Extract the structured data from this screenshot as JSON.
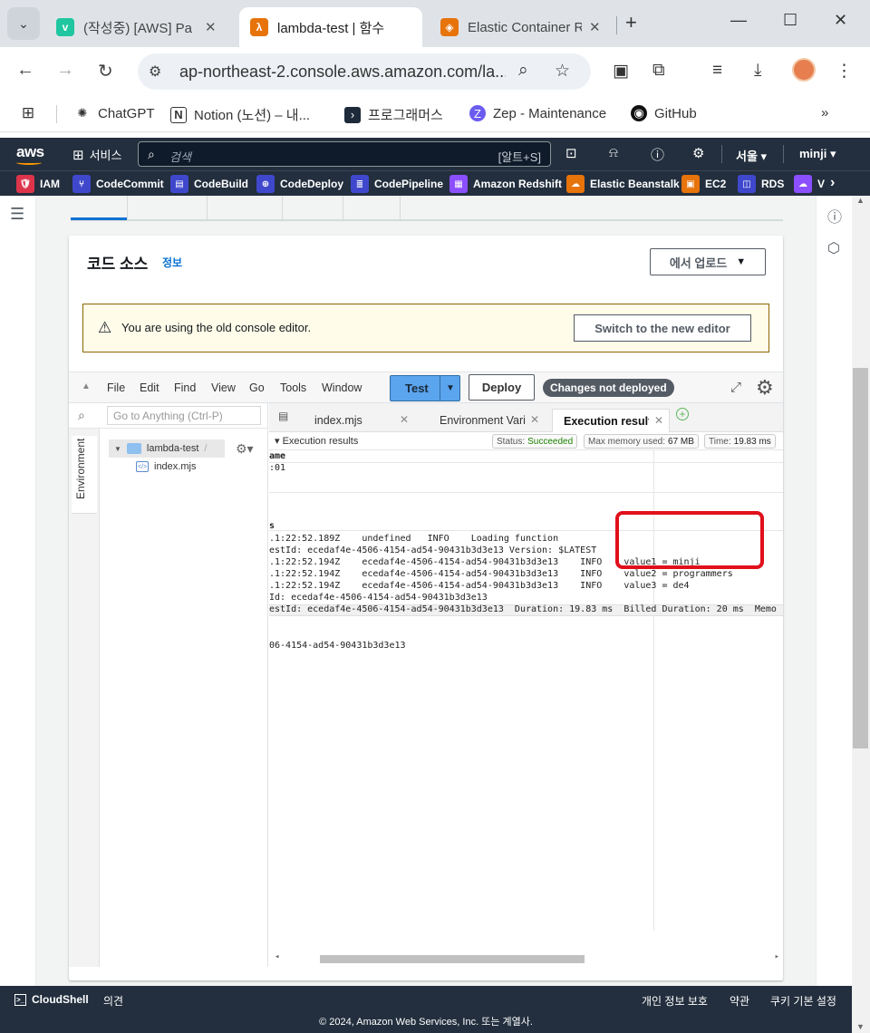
{
  "browser": {
    "tabs": [
      {
        "title": "(작성중) [AWS] Pa",
        "favicon_color": "#1fc6a0",
        "favicon_glyph": "v"
      },
      {
        "title": "lambda-test | 함수",
        "favicon_color": "#e7730b",
        "favicon_glyph": "λ"
      },
      {
        "title": "Elastic Container R",
        "favicon_color": "#e7730b",
        "favicon_glyph": "◈"
      }
    ],
    "url": "ap-northeast-2.console.aws.amazon.com/la...",
    "bookmarks": [
      "ChatGPT",
      "Notion (노션) – 내...",
      "프로그래머스",
      "Zep - Maintenance",
      "GitHub"
    ]
  },
  "aws_nav": {
    "services_label": "서비스",
    "search_placeholder": "검색",
    "search_shortcut": "[알트+S]",
    "region": "서울",
    "user": "minji",
    "favorites": [
      "IAM",
      "CodeCommit",
      "CodeBuild",
      "CodeDeploy",
      "CodePipeline",
      "Amazon Redshift",
      "Elastic Beanstalk",
      "EC2",
      "RDS",
      "V"
    ]
  },
  "panel": {
    "title": "코드 소스",
    "info_link": "정보",
    "upload_label": "에서 업로드",
    "alert_message": "You are using the old console editor.",
    "switch_label": "Switch to the new editor"
  },
  "ide": {
    "menu": [
      "File",
      "Edit",
      "Find",
      "View",
      "Go",
      "Tools",
      "Window"
    ],
    "test_label": "Test",
    "deploy_label": "Deploy",
    "changes_badge": "Changes not deployed",
    "search_placeholder": "Go to Anything (Ctrl-P)",
    "env_tab": "Environment",
    "folder": "lambda-test",
    "folder_suffix": "/",
    "file": "index.mjs",
    "file_tabs": [
      "index.mjs",
      "Environment Vari",
      "Execution results"
    ],
    "results_header": "Execution results",
    "status_label": "Status:",
    "status_value": "Succeeded",
    "memory_label": "Max memory used:",
    "memory_value": "67 MB",
    "time_label": "Time:",
    "time_value": "19.83 ms",
    "output": [
      "ame",
      ":01",
      "s",
      ".1:22:52.189Z    undefined   INFO    Loading function",
      "estId: ecedaf4e-4506-4154-ad54-90431b3d3e13 Version: $LATEST",
      ".1:22:52.194Z    ecedaf4e-4506-4154-ad54-90431b3d3e13    INFO    value1 = minji",
      ".1:22:52.194Z    ecedaf4e-4506-4154-ad54-90431b3d3e13    INFO    value2 = programmers",
      ".1:22:52.194Z    ecedaf4e-4506-4154-ad54-90431b3d3e13    INFO    value3 = de4",
      "Id: ecedaf4e-4506-4154-ad54-90431b3d3e13",
      "estId: ecedaf4e-4506-4154-ad54-90431b3d3e13  Duration: 19.83 ms  Billed Duration: 20 ms  Memo",
      "06-4154-ad54-90431b3d3e13"
    ]
  },
  "footer": {
    "cloudshell": "CloudShell",
    "feedback": "의견",
    "privacy": "개인 정보 보호",
    "terms": "약관",
    "cookies": "쿠키 기본 설정",
    "copyright": "© 2024, Amazon Web Services, Inc. 또는 계열사."
  }
}
